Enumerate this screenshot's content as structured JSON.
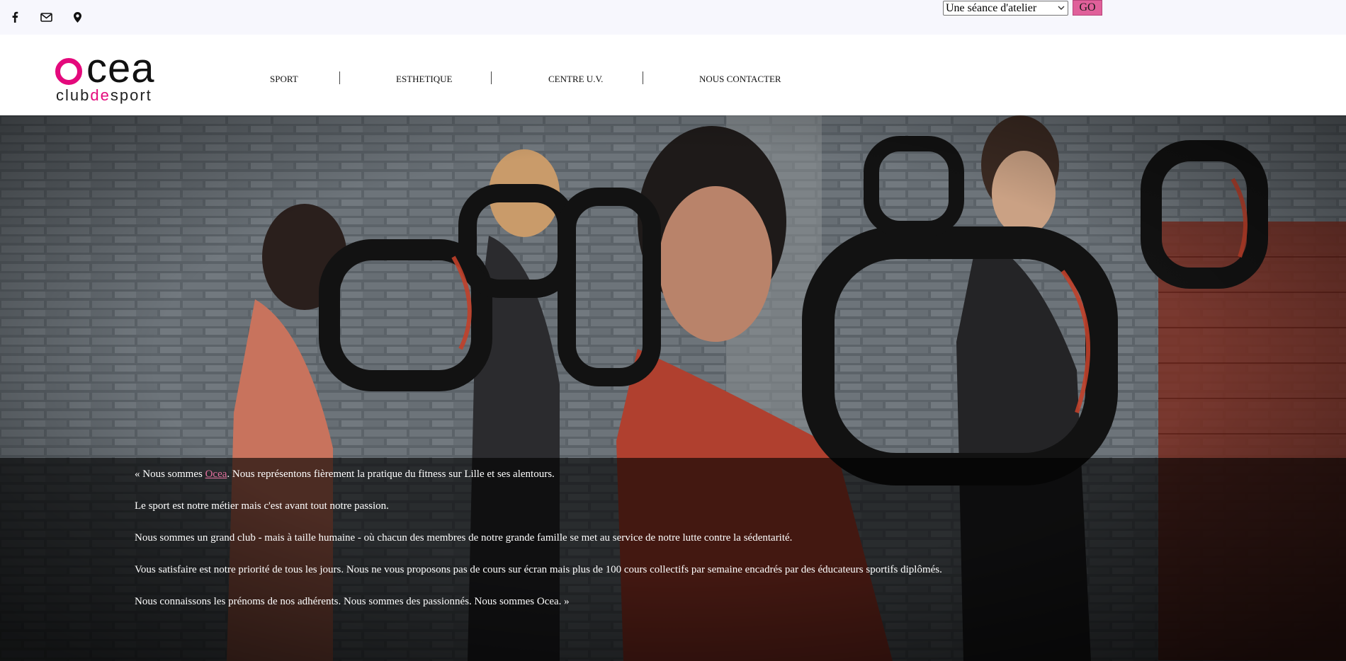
{
  "topbar": {
    "social_icons": [
      "facebook-icon",
      "mail-icon",
      "map-pin-icon"
    ],
    "atelier_select": {
      "selected": "Une séance d'atelier"
    },
    "go_label": "GO"
  },
  "logo": {
    "word": "cea",
    "sub_prefix": "club",
    "sub_mid": "de",
    "sub_suffix": "sport"
  },
  "nav": {
    "items": [
      {
        "label": "SPORT"
      },
      {
        "label": "ESTHETIQUE"
      },
      {
        "label": "CENTRE U.V."
      },
      {
        "label": "NOUS CONTACTER"
      }
    ],
    "separator": "|"
  },
  "intro": {
    "p1_before": "« Nous sommes ",
    "p1_link": "Ocea",
    "p1_after": ". Nous représentons fièrement la pratique du fitness sur Lille et ses alentours.",
    "p2": "Le sport est notre métier mais c'est avant tout notre passion.",
    "p3": "Nous sommes un grand club - mais à taille humaine - où chacun des membres de notre grande famille se met au service de notre lutte contre la sédentarité.",
    "p4": "Vous satisfaire est notre priorité de tous les jours. Nous ne vous proposons pas de cours sur écran mais plus de 100 cours collectifs par semaine encadrés par des éducateurs sportifs diplômés.",
    "p5": "Nous connaissons les prénoms de nos adhérents. Nous sommes des passionnés. Nous sommes Ocea. »"
  },
  "colors": {
    "brand_pink": "#e4097c",
    "go_button": "#e0609a",
    "topbar_bg": "#f7f7fd"
  }
}
